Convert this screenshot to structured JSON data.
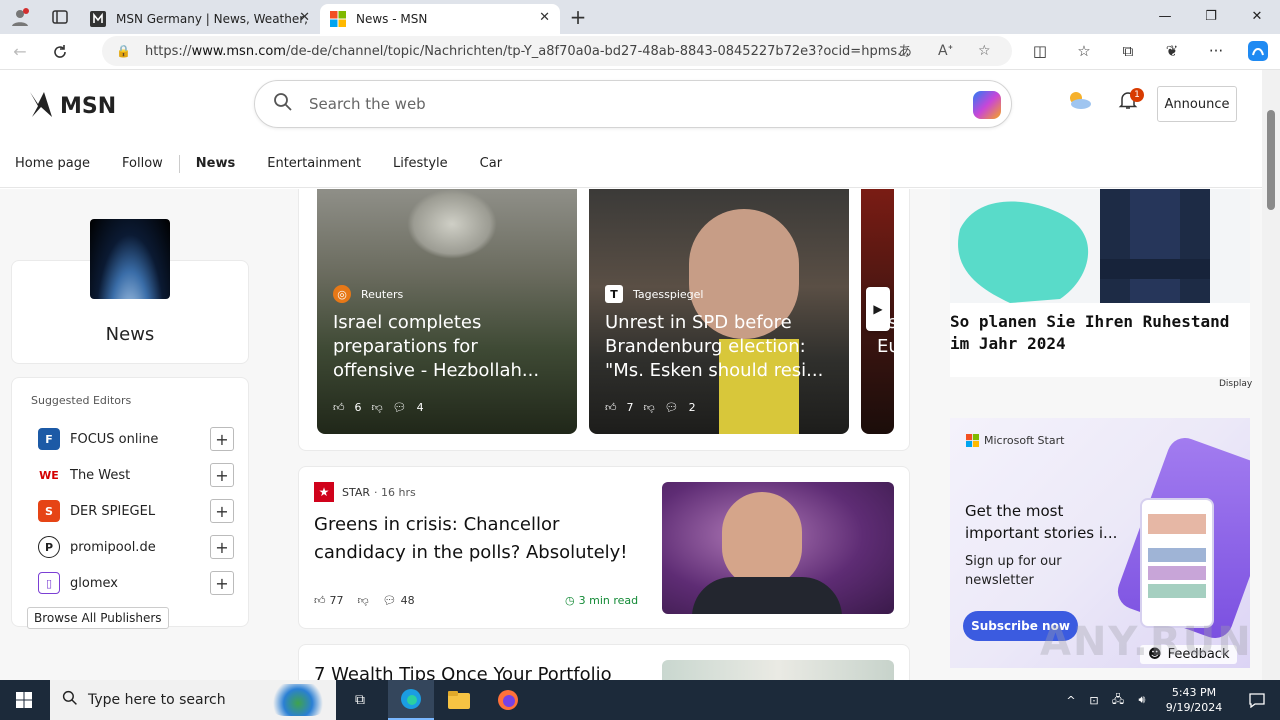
{
  "browser": {
    "tabs": [
      {
        "title": "MSN Germany | News, Weather,",
        "active": false
      },
      {
        "title": "News - MSN",
        "active": true
      }
    ],
    "url_prefix": "https://",
    "url_domain": "www.msn.com",
    "url_rest": "/de-de/channel/topic/Nachrichten/tp-Y_a8f70a0a-bd27-48ab-8843-0845227b72e3?ocid=hpms...",
    "win_minimize": "—",
    "win_restore": "❐",
    "win_close": "✕"
  },
  "msn": {
    "logo_text": "MSN",
    "search_placeholder": "Search the web",
    "notification_count": "1",
    "announce_label": "Announce",
    "nav": [
      "Home page",
      "Follow",
      "News",
      "Entertainment",
      "Lifestyle",
      "Car"
    ]
  },
  "profile": {
    "name": "News"
  },
  "editors": {
    "title": "Suggested Editors",
    "items": [
      {
        "name": "FOCUS online",
        "logo": "F",
        "color": "#c8102e"
      },
      {
        "name": "The West",
        "logo": "WE",
        "color": "#d40000"
      },
      {
        "name": "DER SPIEGEL",
        "logo": "S",
        "color": "#e64415"
      },
      {
        "name": "promipool.de",
        "logo": "P",
        "color": "#222222"
      },
      {
        "name": "glomex",
        "logo": "g",
        "color": "#7b3fd4"
      }
    ],
    "browse_label": "Browse All Publishers"
  },
  "carousel": [
    {
      "source": "Reuters",
      "title": "Israel completes preparations for offensive - Hezbollah...",
      "likes": "6",
      "comments": "4"
    },
    {
      "source": "Tagesspiegel",
      "title": "Unrest in SPD before Brandenburg election: \"Ms. Esken should resi...",
      "likes": "7",
      "comments": "2"
    },
    {
      "source": "",
      "title": "as Eu",
      "likes": "",
      "comments": ""
    }
  ],
  "article": {
    "source": "STAR",
    "time": "· 16 hrs",
    "title": "Greens in crisis: Chancellor candidacy in the polls? Absolutely!",
    "likes": "77",
    "comments": "48",
    "read_time": "3 min read"
  },
  "article2": {
    "title": "7 Wealth Tips Once Your Portfolio"
  },
  "ad1": {
    "text": "So planen Sie Ihren Ruhestand im Jahr 2024",
    "label": "Display"
  },
  "ad2": {
    "brand": "Microsoft Start",
    "headline": "Get the most important stories i...",
    "sub": "Sign up for our newsletter",
    "cta": "Subscribe now",
    "feedback": "Feedback"
  },
  "taskbar": {
    "search_placeholder": "Type here to search",
    "time": "5:43 PM",
    "date": "9/19/2024"
  },
  "watermark": "ANY.RUN"
}
